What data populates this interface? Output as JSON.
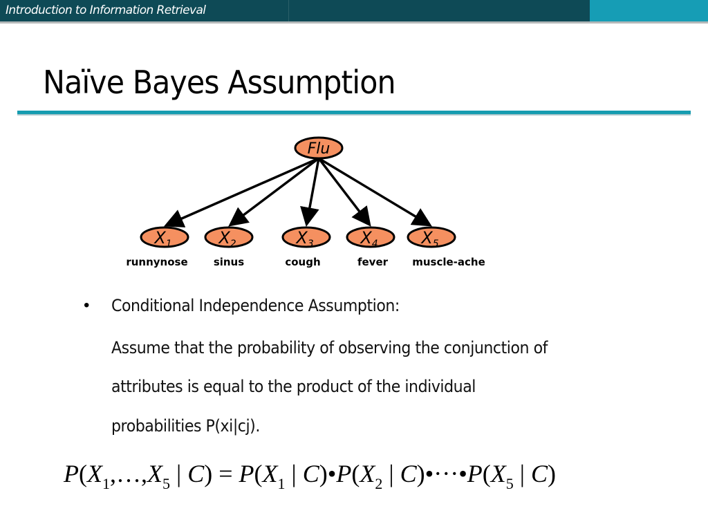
{
  "header": {
    "course_title": "Introduction to Information Retrieval",
    "colors": {
      "bar": "#0e4a56",
      "accent": "#169db5",
      "rule": "#159cb0"
    }
  },
  "slide": {
    "title": "Naïve Bayes Assumption"
  },
  "diagram": {
    "node_fill": "#f59060",
    "root": {
      "label": "Flu"
    },
    "children": [
      {
        "label": "X",
        "sub": "1",
        "name": "runnynose"
      },
      {
        "label": "X",
        "sub": "2",
        "name": "sinus"
      },
      {
        "label": "X",
        "sub": "3",
        "name": "cough"
      },
      {
        "label": "X",
        "sub": "4",
        "name": "fever"
      },
      {
        "label": "X",
        "sub": "5",
        "name": "muscle-ache"
      }
    ]
  },
  "content": {
    "bullet_symbol": "•",
    "bullet_heading": "Conditional Independence Assumption:",
    "paragraph_lines": [
      "Assume that the probability of observing the conjunction of",
      "attributes is equal to the product of the individual",
      "probabilities P(xi|cj)."
    ]
  },
  "formula": {
    "lhs": "P(X1,…,X5 | C)",
    "rhs": "P(X1 | C) • P(X2 | C) • ··· • P(X5 | C)"
  }
}
